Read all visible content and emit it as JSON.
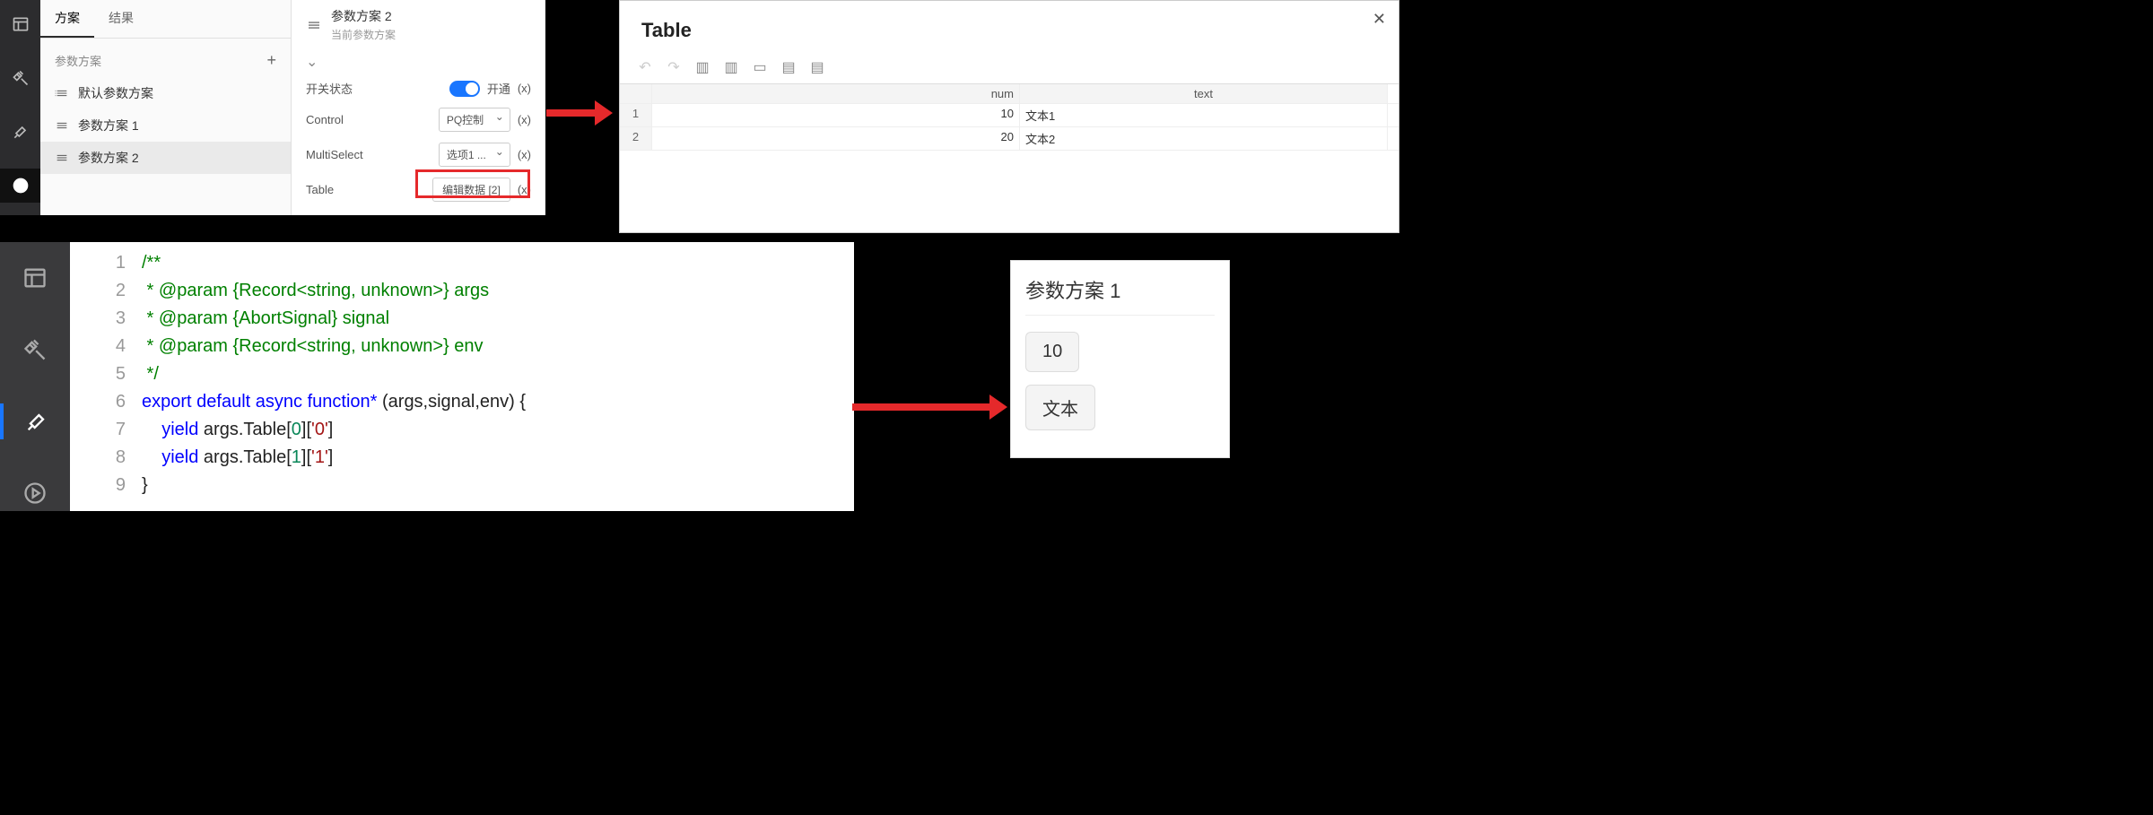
{
  "panel1": {
    "tabs": {
      "scheme": "方案",
      "result": "结果"
    },
    "list_header": "参数方案",
    "items": [
      {
        "label": "默认参数方案"
      },
      {
        "label": "参数方案 1"
      },
      {
        "label": "参数方案 2"
      }
    ],
    "prop": {
      "title": "参数方案 2",
      "subtitle": "当前参数方案",
      "rows": {
        "switch": {
          "label": "开关状态",
          "state": "开通",
          "x": "(x)"
        },
        "control": {
          "label": "Control",
          "value": "PQ控制",
          "x": "(x)"
        },
        "multiselect": {
          "label": "MultiSelect",
          "value": "选项1 ...",
          "x": "(x)"
        },
        "table": {
          "label": "Table",
          "button": "编辑数据 [2]",
          "x": "(x)"
        }
      }
    }
  },
  "panel2": {
    "title": "Table",
    "headers": {
      "num": "num",
      "text": "text"
    },
    "rows": [
      {
        "idx": "1",
        "num": "10",
        "text": "文本1"
      },
      {
        "idx": "2",
        "num": "20",
        "text": "文本2"
      }
    ]
  },
  "panel3": {
    "code": {
      "l1_a": "/**",
      "l2_a": " * @param {Record<string, unknown>} args",
      "l3_a": " * @param {AbortSignal} signal",
      "l4_a": " * @param {Record<string, unknown>} env",
      "l5_a": " */",
      "l6_export": "export",
      "l6_default": "default",
      "l6_async": "async",
      "l6_function": "function*",
      "l6_params": " (args,signal,env) {",
      "l7_yield": "yield",
      "l7_rest": " args.Table[",
      "l7_idx": "0",
      "l7_mid": "][",
      "l7_key": "'0'",
      "l7_end": "]",
      "l8_yield": "yield",
      "l8_rest": " args.Table[",
      "l8_idx": "1",
      "l8_mid": "][",
      "l8_key": "'1'",
      "l8_end": "]",
      "l9": "}"
    },
    "linenums": [
      "1",
      "2",
      "3",
      "4",
      "5",
      "6",
      "7",
      "8",
      "9"
    ]
  },
  "panel4": {
    "title": "参数方案 1",
    "chip1": "10",
    "chip2": "文本"
  }
}
